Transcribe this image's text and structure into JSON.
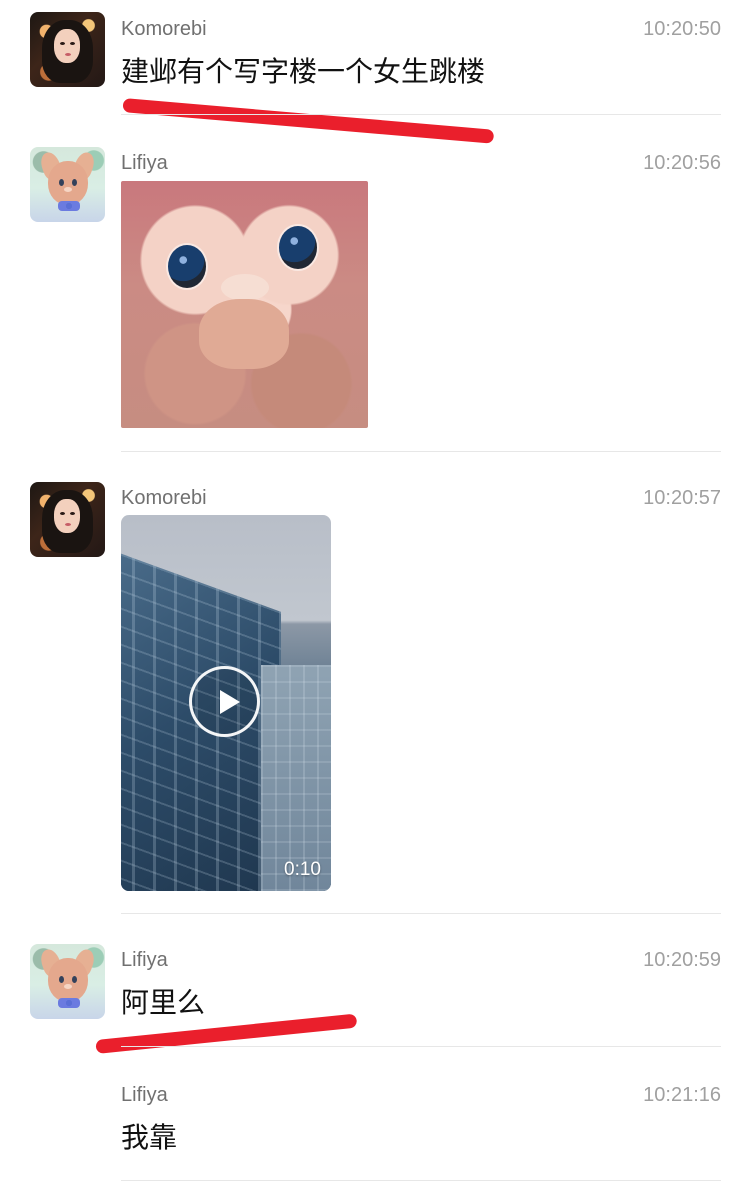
{
  "messages": [
    {
      "sender": "Komorebi",
      "time": "10:20:50",
      "text": "建邺有个写字楼一个女生跳楼"
    },
    {
      "sender": "Lifiya",
      "time": "10:20:56"
    },
    {
      "sender": "Komorebi",
      "time": "10:20:57",
      "video_duration": "0:10"
    },
    {
      "sender": "Lifiya",
      "time": "10:20:59",
      "text": "阿里么"
    },
    {
      "sender": "Lifiya",
      "time": "10:21:16",
      "text": "我靠"
    }
  ],
  "colors": {
    "name": "#707070",
    "time": "#a0a0a0",
    "text": "#111111",
    "divider": "#e7e7e7",
    "annotation": "#ea1f2c"
  },
  "icons": {
    "play": "play-icon"
  }
}
